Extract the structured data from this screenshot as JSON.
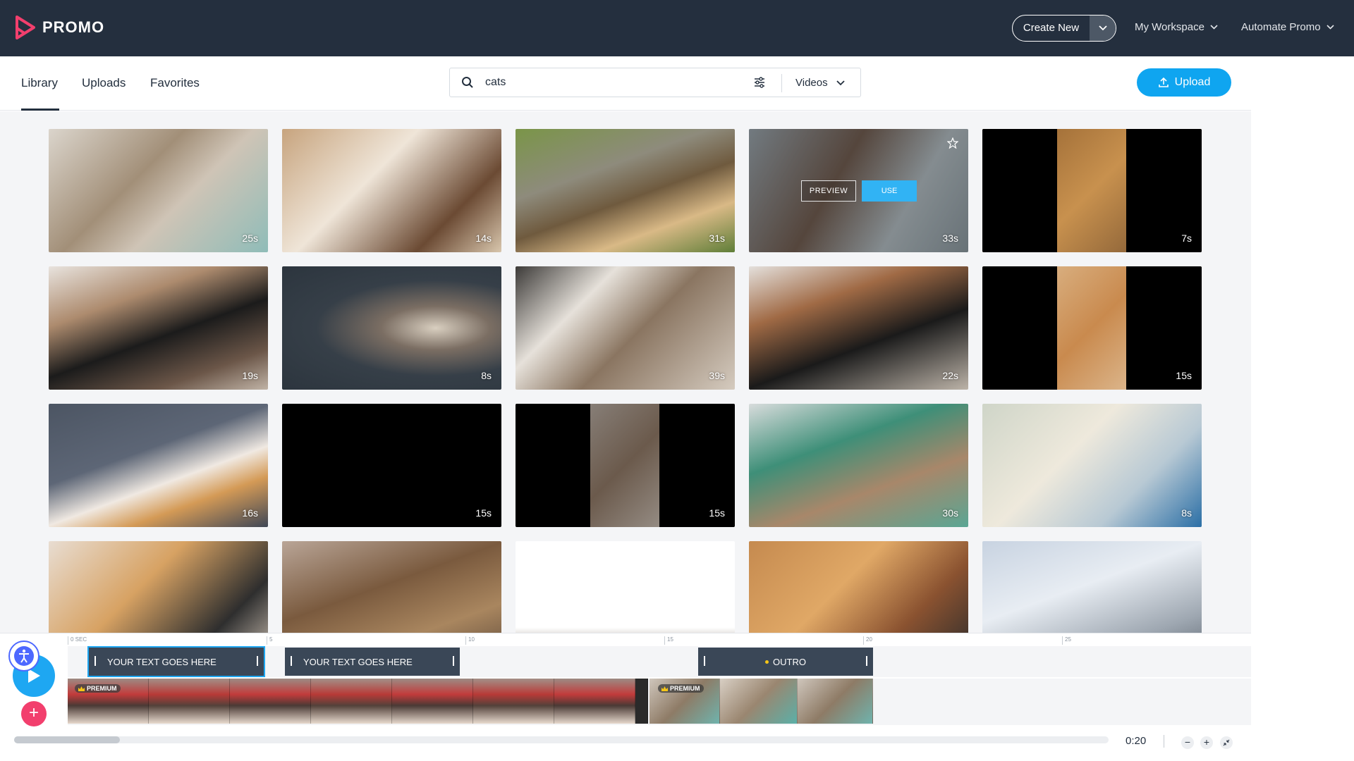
{
  "brand": {
    "name": "PROMO",
    "color": "#f23f6d"
  },
  "topbar": {
    "create_new": "Create New",
    "workspace": "My Workspace",
    "automate": "Automate Promo"
  },
  "library": {
    "tabs": [
      "Library",
      "Uploads",
      "Favorites"
    ],
    "active_tab": "Library",
    "search_value": "cats",
    "media_type": "Videos",
    "upload_label": "Upload"
  },
  "grid": {
    "items": [
      {
        "duration": "25s"
      },
      {
        "duration": "14s"
      },
      {
        "duration": "31s"
      },
      {
        "duration": "33s",
        "preview": "PREVIEW",
        "use": "USE"
      },
      {
        "duration": "7s"
      },
      {
        "duration": "19s"
      },
      {
        "duration": "8s"
      },
      {
        "duration": "39s"
      },
      {
        "duration": "22s"
      },
      {
        "duration": "15s"
      },
      {
        "duration": "16s"
      },
      {
        "duration": "15s"
      },
      {
        "duration": "15s"
      },
      {
        "duration": "30s"
      },
      {
        "duration": "8s"
      },
      {
        "duration": ""
      },
      {
        "duration": ""
      },
      {
        "duration": ""
      },
      {
        "duration": ""
      },
      {
        "duration": ""
      }
    ]
  },
  "timeline": {
    "ruler": [
      "0 SEC",
      "5",
      "10",
      "15",
      "20",
      "25"
    ],
    "text_clips": [
      "YOUR TEXT GOES HERE",
      "YOUR TEXT GOES HERE",
      "OUTRO"
    ],
    "premium_badge": "PREMIUM",
    "time": "0:20",
    "zoom_out": "−",
    "zoom_in": "+",
    "add": "+"
  }
}
